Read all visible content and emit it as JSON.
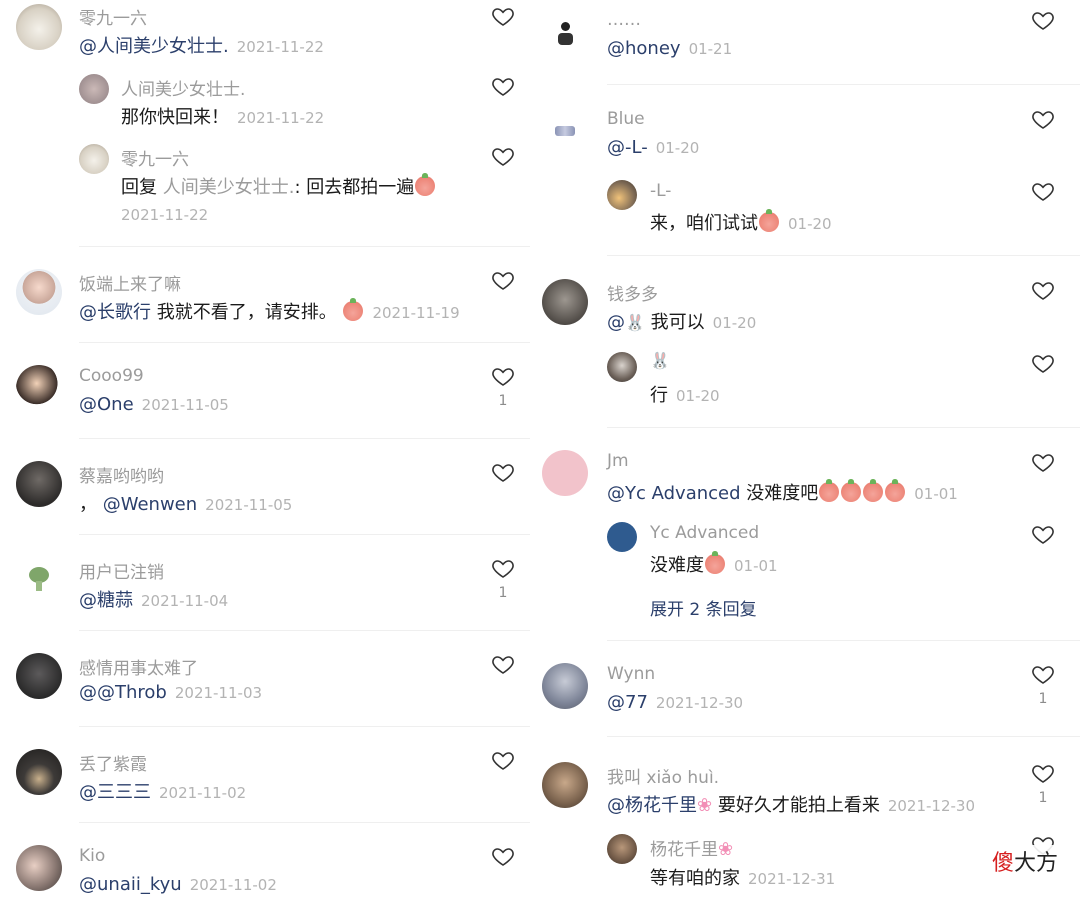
{
  "left": {
    "comments": [
      {
        "name": "零九一六",
        "mention": "@人间美少女壮士.",
        "text": "",
        "date": "2021-11-22",
        "likes": "",
        "replies": [
          {
            "name": "人间美少女壮士.",
            "text": "那你快回来！",
            "date": "2021-11-22"
          },
          {
            "name": "零九一六",
            "prefix": "回复",
            "reply_to": "人间美少女壮士.",
            "text": ": 回去都拍一遍",
            "date": "2021-11-22"
          }
        ]
      },
      {
        "name": "饭端上来了嘛",
        "mention": "@长歌行",
        "text": " 我就不看了，请安排。",
        "date": "2021-11-19",
        "likes": ""
      },
      {
        "name": "Cooo99",
        "mention": "@One",
        "text": "",
        "date": "2021-11-05",
        "likes": "1"
      },
      {
        "name": "蔡嘉哟哟哟",
        "mention": "@Wenwen",
        "text": "",
        "prefix": "，",
        "date": "2021-11-05",
        "likes": ""
      },
      {
        "name": "用户已注销",
        "mention": "@糖蒜",
        "text": "",
        "date": "2021-11-04",
        "likes": "1"
      },
      {
        "name": "感情用事太难了",
        "mention": "@@Throb",
        "text": "",
        "date": "2021-11-03",
        "likes": ""
      },
      {
        "name": "丢了紫霞",
        "mention": "@三三三",
        "text": "",
        "date": "2021-11-02",
        "likes": ""
      },
      {
        "name": "Kio",
        "mention": "@unaii_kyu",
        "text": "",
        "date": "2021-11-02",
        "likes": ""
      }
    ]
  },
  "right": {
    "comments": [
      {
        "name": "……",
        "mention": "@honey",
        "date": "01-21"
      },
      {
        "name": "Blue",
        "mention": "@-L-",
        "date": "01-20",
        "replies": [
          {
            "name": "-L-",
            "text": "来，咱们试试",
            "date": "01-20"
          }
        ]
      },
      {
        "name": "钱多多",
        "mention": "@",
        "text": " 我可以",
        "date": "01-20",
        "replies": [
          {
            "name": "",
            "text": "行",
            "date": "01-20"
          }
        ]
      },
      {
        "name": "Jm",
        "mention": "@Yc Advanced",
        "text": " 没难度吧",
        "date": "01-01",
        "replies": [
          {
            "name": "Yc Advanced",
            "text": "没难度",
            "date": "01-01"
          }
        ],
        "expand": "展开 2 条回复"
      },
      {
        "name": "Wynn",
        "mention": "@77",
        "date": "2021-12-30",
        "likes": "1"
      },
      {
        "name": "我叫 xiǎo huì.",
        "mention": "@杨花千里",
        "text": " 要好久才能拍上看来",
        "date": "2021-12-30",
        "likes": "1",
        "replies": [
          {
            "name": "杨花千里",
            "text": "等有咱的家",
            "date": "2021-12-31"
          }
        ]
      }
    ]
  },
  "watermark": {
    "red": "傻",
    "rest": "大方"
  },
  "colors": {
    "mention": "#2b3f6b",
    "muted": "#9b9b9b",
    "date": "#b3b3b3"
  }
}
